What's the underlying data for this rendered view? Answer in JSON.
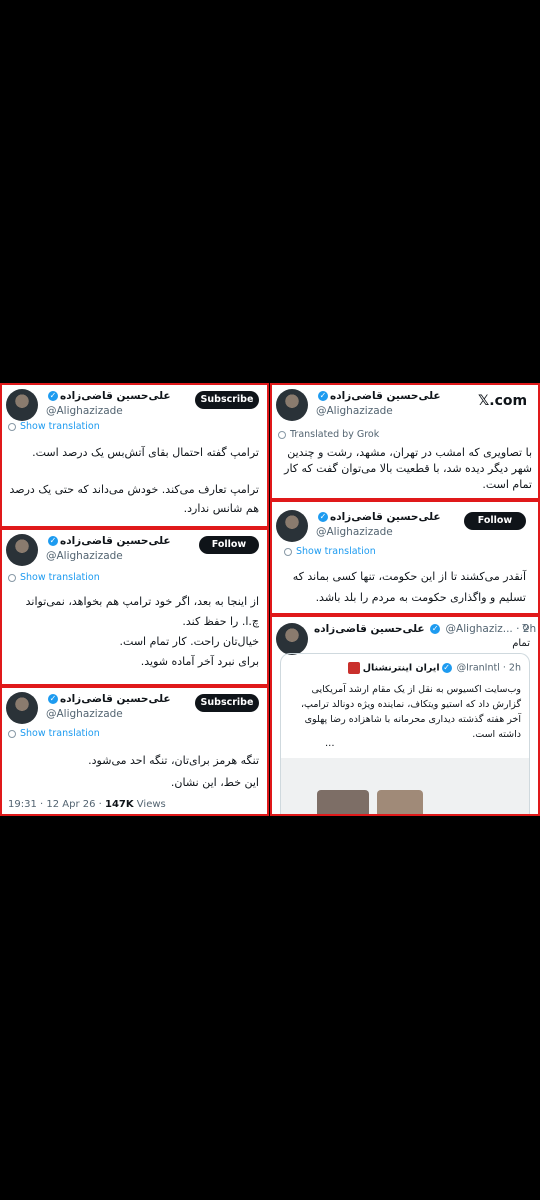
{
  "author": {
    "name": "علی‌حسین قاضی‌زاده",
    "handle": "@Alighazizade",
    "handle_truncated": "@Alighaziz...",
    "verified_mark": "✓"
  },
  "buttons": {
    "subscribe": "Subscribe",
    "follow": "Follow"
  },
  "links": {
    "show_translation": "Show translation",
    "translated_by": "Translated by Grok"
  },
  "brand": {
    "x_logo": "𝕏.com"
  },
  "tweets": {
    "left1": {
      "lines": [
        "ترامپ گفته احتمال بقای آتش‌بس یک درصد است.",
        "ترامپ تعارف می‌کند. خودش می‌داند که حتی یک درصد هم شانس ندارد."
      ]
    },
    "left2": {
      "lines": [
        "از اینجا به بعد، اگر خود ترامپ هم بخواهد، نمی‌تواند چ.ا. را حفظ کند.",
        "خیال‌تان راحت. کار تمام است.",
        "برای نبرد آخر آماده شوید."
      ]
    },
    "left3": {
      "lines": [
        "تنگه هرمز برای‌تان، تنگه احد می‌شود.",
        "این خط، این نشان."
      ],
      "time": "19:31 · 12 Apr 26 · ",
      "views_count": "147K",
      "views_label": " Views"
    },
    "right1": {
      "lines": [
        "با تصاویری که امشب در تهران، مشهد، رشت و چندین شهر دیگر دیده شد، با قطعیت بالا می‌توان گفت که کار تمام است."
      ]
    },
    "right2": {
      "lines": [
        "آنقدر می‌کشند تا از این حکومت، تنها کسی بماند که تسلیم و واگذاری حکومت به مردم را بلد باشد."
      ]
    },
    "right3": {
      "time": "· 2h",
      "text": "تمام",
      "quoted": {
        "name": "ایران اینترنشنال",
        "handle": "@IranIntl · 2h",
        "text": "وب‌سایت اکسیوس به نقل از یک مقام ارشد آمریکایی گزارش داد که استیو ویتکاف، نماینده ویژه دونالد ترامپ، آخر هفته گذشته دیداری محرمانه با شاهزاده رضا پهلوی داشته است.",
        "ellipsis": "..."
      }
    }
  },
  "colors": {
    "highlight_border": "#e0191a",
    "link": "#1d9bf0",
    "button": "#0f1419"
  }
}
